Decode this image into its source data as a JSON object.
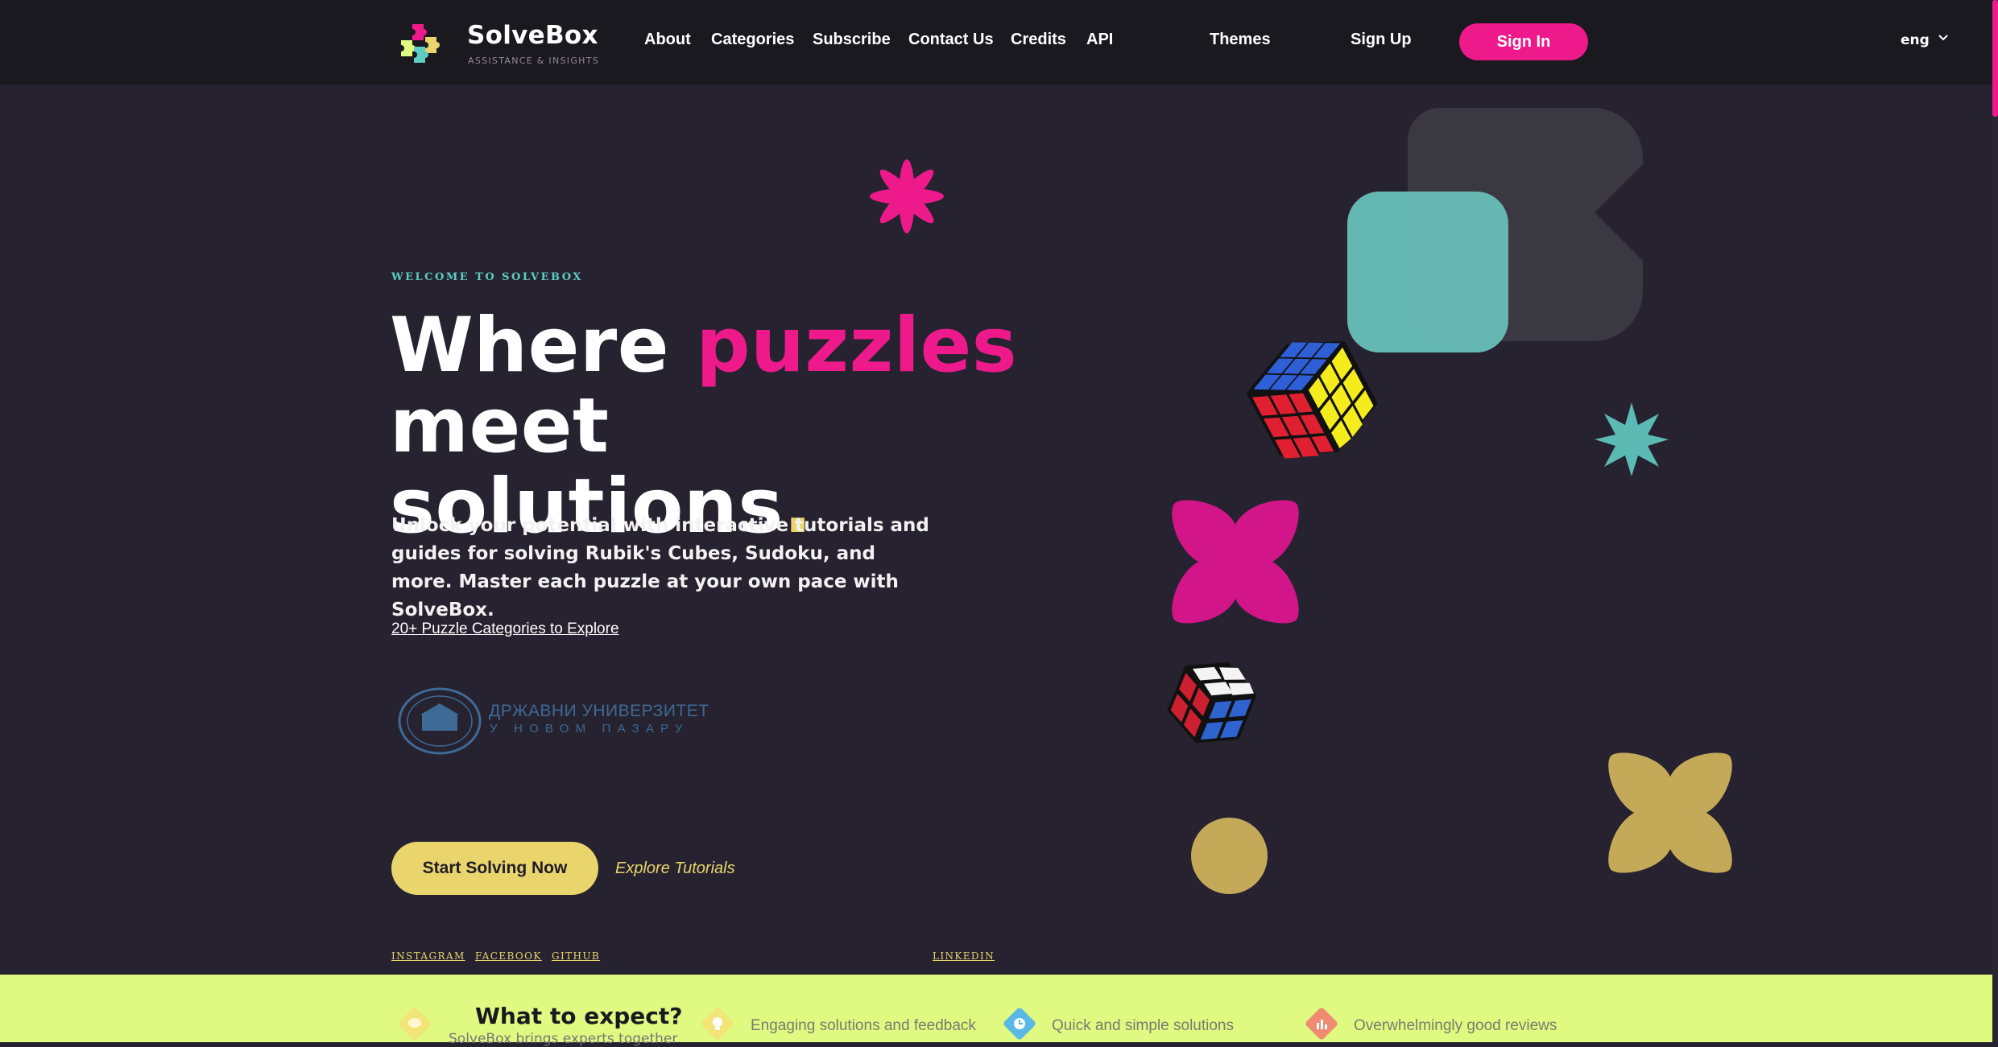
{
  "colors": {
    "background": "#26222f",
    "topbar": "#1b1920",
    "pink": "#ee1a8c",
    "yellow": "#e9d56c",
    "teal": "#5ccfc2",
    "lime": "#e0f980"
  },
  "header": {
    "brand": "SolveBox",
    "tagline": "ASSISTANCE & INSIGHTS",
    "logo_icon": "puzzle-pieces-icon",
    "nav": [
      "About",
      "Categories",
      "Subscribe",
      "Contact Us",
      "Credits",
      "API"
    ],
    "themes": "Themes",
    "sign_up": "Sign Up",
    "sign_in": "Sign In",
    "language": "eng"
  },
  "hero": {
    "eyebrow": "WELCOME TO SOLVEBOX",
    "headline_part1": "Where ",
    "headline_highlight": "puzzles",
    "headline_part2": "meet solutions",
    "headline_dot": ".",
    "description": "Unlock your potential with interactive tutorials and guides for solving Rubik's Cubes, Sudoku, and more. Master each puzzle at your own pace with SolveBox.",
    "categories_link": "20+ Puzzle Categories to Explore",
    "university_line1": "ДРЖАВНИ УНИВЕРЗИТЕТ",
    "university_line2": "У НОВОМ ПАЗАРУ",
    "cta_primary": "Start Solving Now",
    "cta_secondary": "Explore Tutorials"
  },
  "social": [
    "INSTAGRAM",
    "FACEBOOK",
    "GITHUB",
    "LINKEDIN"
  ],
  "expect": {
    "title": "What to expect?",
    "subtitle": "SolveBox brings experts together",
    "features": [
      {
        "label": "Engaging solutions and feedback",
        "icon": "lightbulb-icon"
      },
      {
        "label": "Quick and simple solutions",
        "icon": "clock-icon"
      },
      {
        "label": "Overwhelmingly good reviews",
        "icon": "bar-chart-icon"
      }
    ]
  }
}
